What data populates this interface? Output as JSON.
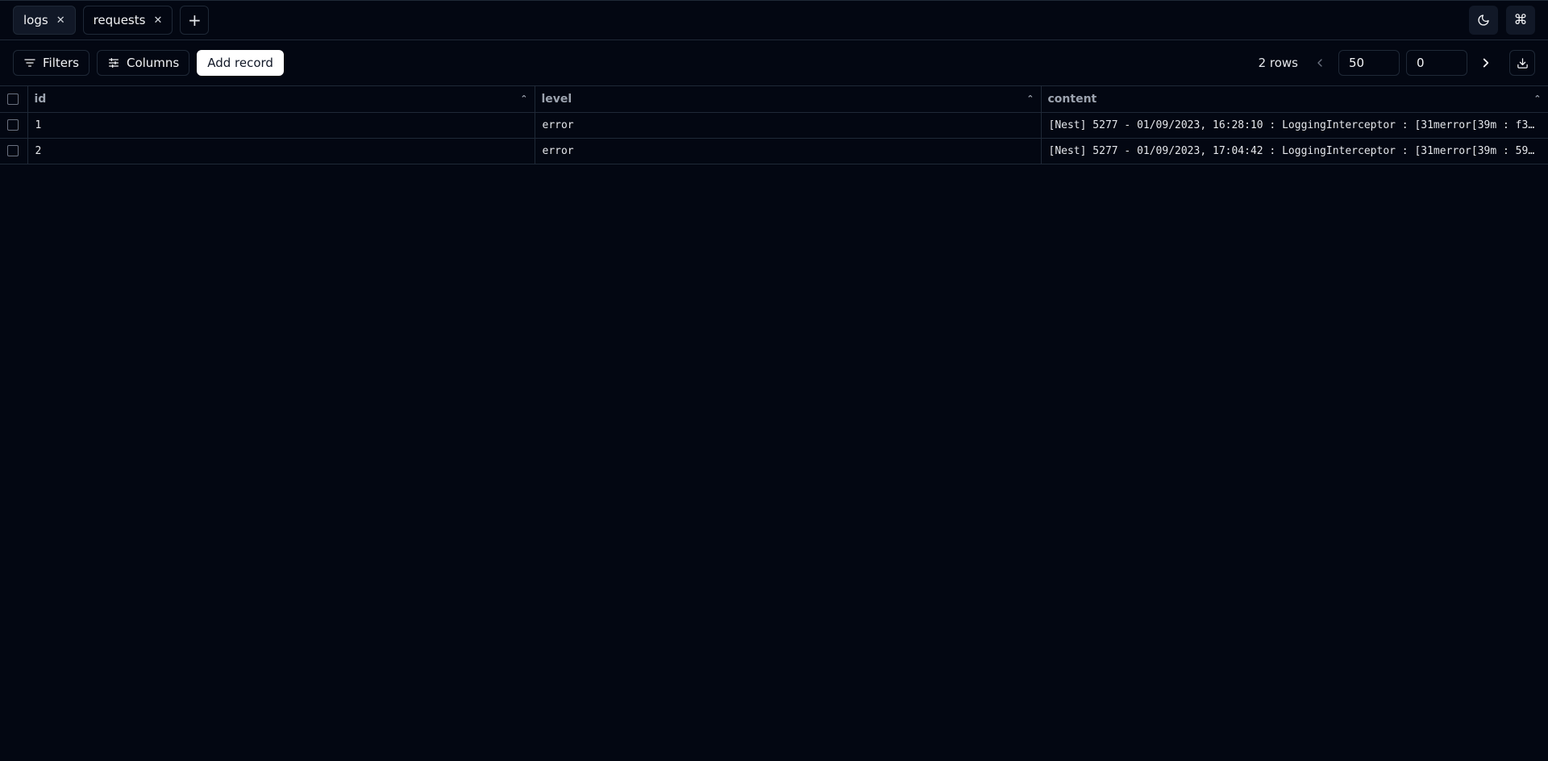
{
  "tabs": [
    {
      "label": "logs",
      "active": true
    },
    {
      "label": "requests",
      "active": false
    }
  ],
  "toolbar": {
    "filters_label": "Filters",
    "columns_label": "Columns",
    "add_record_label": "Add record",
    "rows_count": "2 rows",
    "limit_value": "50",
    "offset_value": "0"
  },
  "table": {
    "columns": [
      "id",
      "level",
      "content"
    ],
    "rows": [
      {
        "id": "1",
        "level": "error",
        "content": "[Nest] 5277  - 01/09/2023, 16:28:10 : LoggingInterceptor : \u001b[31merror\u001b[39m : f3…"
      },
      {
        "id": "2",
        "level": "error",
        "content": "[Nest] 5277  - 01/09/2023, 17:04:42 : LoggingInterceptor : \u001b[31merror\u001b[39m : 59…"
      }
    ]
  },
  "icons": {
    "theme": "moon-icon",
    "command": "command-icon"
  },
  "colors": {
    "background": "#030712",
    "border": "#1f2937",
    "primary_button": "#ffffff"
  }
}
